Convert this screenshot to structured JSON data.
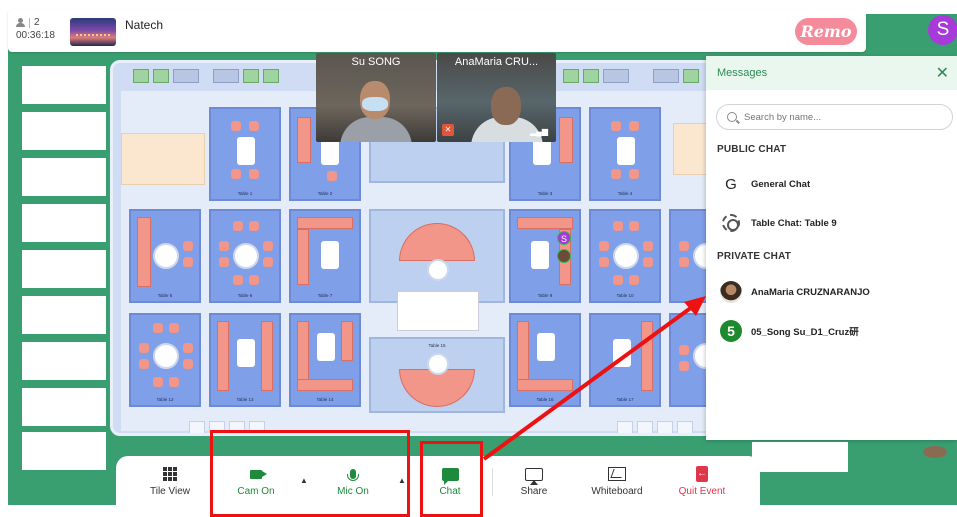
{
  "topbar": {
    "attendee_count": "2",
    "timer": "00:36:18",
    "event_name": "Natech",
    "logo_text": "Remo",
    "user_initial": "S"
  },
  "videos": [
    {
      "name": "Su SONG"
    },
    {
      "name": "AnaMaria CRU..."
    }
  ],
  "floor": {
    "tables": [
      {
        "label": "Table 1"
      },
      {
        "label": "Table 2"
      },
      {
        "label": "Table 3"
      },
      {
        "label": "Table 4"
      },
      {
        "label": "Table 5"
      },
      {
        "label": "Table 6"
      },
      {
        "label": "Table 7"
      },
      {
        "label": "Table 8"
      },
      {
        "label": "Table 9"
      },
      {
        "label": "Table 10"
      },
      {
        "label": "Table 12"
      },
      {
        "label": "Table 13"
      },
      {
        "label": "Table 14"
      },
      {
        "label": "Table 15"
      },
      {
        "label": "Table 16"
      },
      {
        "label": "Table 17"
      }
    ],
    "seat_badge": "S"
  },
  "messages": {
    "title": "Messages",
    "search_placeholder": "Search by name...",
    "public_title": "PUBLIC CHAT",
    "private_title": "PRIVATE CHAT",
    "public_chats": [
      {
        "label": "General Chat",
        "icon": "G"
      },
      {
        "label": "Table Chat: Table 9"
      }
    ],
    "private_chats": [
      {
        "label": "AnaMaria CRUZNARANJO"
      },
      {
        "label": "05_Song Su_D1_Cruz研",
        "icon": "5"
      }
    ]
  },
  "toolbar": {
    "tile_view": "Tile View",
    "cam_on": "Cam On",
    "mic_on": "Mic On",
    "chat": "Chat",
    "share": "Share",
    "whiteboard": "Whiteboard",
    "quit": "Quit Event"
  },
  "colors": {
    "brand_green": "#1e8a3c",
    "backdrop_green": "#3a9f70",
    "remo_pink": "#f58a9b",
    "quit_red": "#e0364c",
    "annotation_red": "#ee1111"
  }
}
